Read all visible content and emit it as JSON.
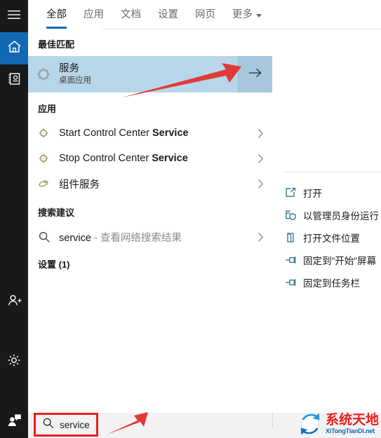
{
  "window": {
    "title": "Windows Search",
    "query": "service"
  },
  "colors": {
    "accent": "#1268b3",
    "rail_bg": "#191919",
    "best_match_bg": "#b8d6ea",
    "best_match_button_bg": "#a7c7dd",
    "annotation_red": "#e8201f",
    "action_icon": "#2b6f8c",
    "taskbar_bg": "#f2f2f2"
  },
  "rail": {
    "items": [
      {
        "name": "hamburger-menu",
        "icon": "hamburger-icon",
        "active": false
      },
      {
        "name": "home",
        "icon": "home-icon",
        "active": true
      },
      {
        "name": "documents",
        "icon": "notebook-icon",
        "active": false
      },
      {
        "name": "account",
        "icon": "person-add-icon",
        "active": false
      },
      {
        "name": "settings",
        "icon": "gear-icon",
        "active": false
      },
      {
        "name": "feedback",
        "icon": "feedback-person-icon",
        "active": false
      }
    ]
  },
  "tabs": [
    {
      "label": "全部",
      "active": true,
      "caret": false
    },
    {
      "label": "应用",
      "active": false,
      "caret": false
    },
    {
      "label": "文档",
      "active": false,
      "caret": false
    },
    {
      "label": "设置",
      "active": false,
      "caret": false
    },
    {
      "label": "网页",
      "active": false,
      "caret": false
    },
    {
      "label": "更多",
      "active": false,
      "caret": true
    }
  ],
  "best_match": {
    "heading": "最佳匹配",
    "title": "服务",
    "subtitle": "桌面应用",
    "icon": "services-gear-icon",
    "arrow_button_icon": "arrow-right-icon"
  },
  "apps": {
    "heading": "应用",
    "items": [
      {
        "prefix": "Start Control Center ",
        "bold": "Service",
        "suffix": "",
        "icon": "app-gear-icon"
      },
      {
        "prefix": "Stop Control Center ",
        "bold": "Service",
        "suffix": "",
        "icon": "app-gear-icon"
      },
      {
        "prefix": "组件服务",
        "bold": "",
        "suffix": "",
        "icon": "component-services-icon"
      }
    ]
  },
  "suggestions": {
    "heading": "搜索建议",
    "items": [
      {
        "query": "service",
        "separator": " - ",
        "hint": "查看网络搜索结果",
        "icon": "search-icon"
      }
    ]
  },
  "settings_section": {
    "heading": "设置 (1)"
  },
  "right_panel": {
    "actions": [
      {
        "label": "打开",
        "icon": "open-icon"
      },
      {
        "label": "以管理员身份运行",
        "icon": "shield-run-icon"
      },
      {
        "label": "打开文件位置",
        "icon": "folder-location-icon"
      },
      {
        "label": "固定到\"开始\"屏幕",
        "icon": "pin-icon"
      },
      {
        "label": "固定到任务栏",
        "icon": "pin-icon"
      }
    ]
  },
  "taskbar": {
    "search_value": "service",
    "search_icon": "search-icon"
  },
  "watermark": {
    "name_cn": "系统天地",
    "name_en": "XiTongTianDi.net",
    "logo": "globe-arrows-logo"
  },
  "annotations": [
    {
      "name": "arrow-to-best-match-button",
      "color": "#e8201f"
    },
    {
      "name": "arrow-to-search-box",
      "color": "#e8201f"
    }
  ]
}
